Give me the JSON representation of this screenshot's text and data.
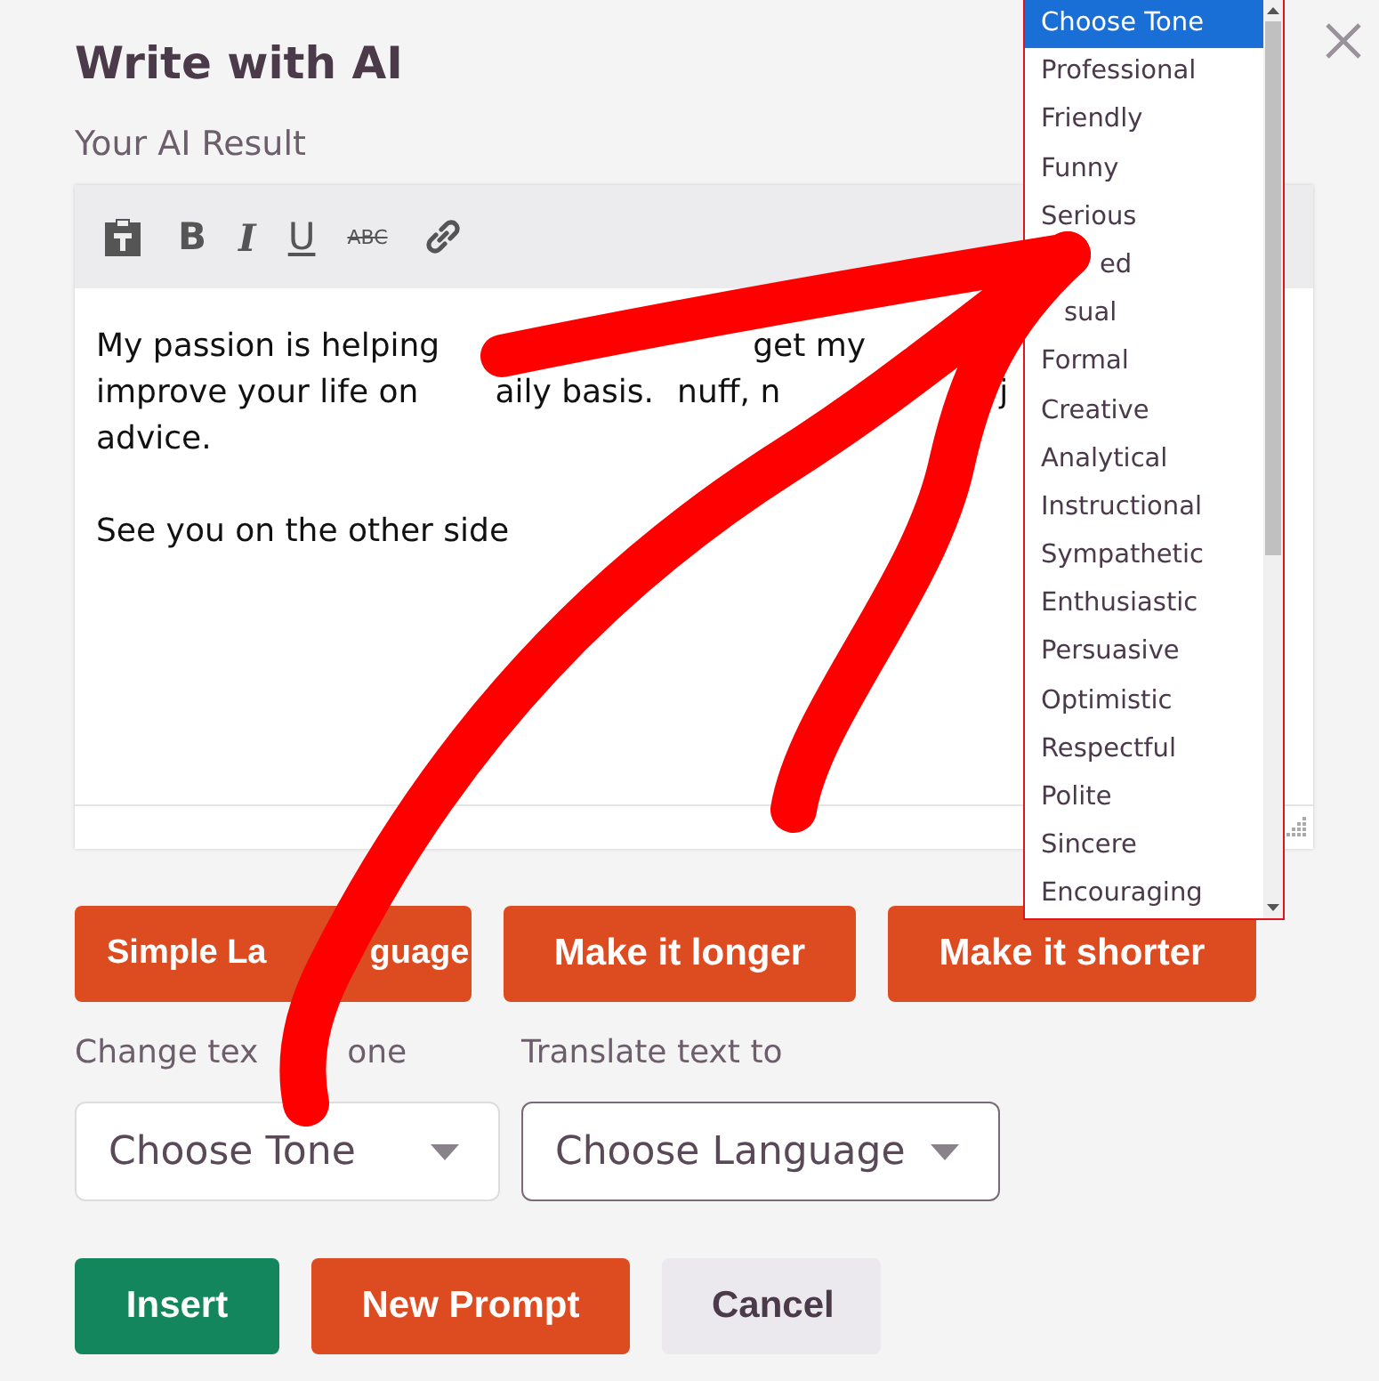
{
  "dialog": {
    "title": "Write with AI"
  },
  "result_label": "Your AI Result",
  "toolbar": [
    {
      "kind": "paste"
    },
    {
      "kind": "bold",
      "label": "B"
    },
    {
      "kind": "italic",
      "label": "I"
    },
    {
      "kind": "underline",
      "label": "U"
    },
    {
      "kind": "strikethrough",
      "label": "ABC"
    },
    {
      "kind": "link"
    }
  ],
  "editor": {
    "paragraphs": [
      {
        "lines": [
          [
            "My passion is helping",
            "get my"
          ],
          [
            "improve your life on",
            "aily basis.",
            "nuff, n",
            "j"
          ],
          [
            "advice."
          ]
        ]
      },
      {
        "lines": [
          [
            "See you on the other side"
          ]
        ]
      }
    ]
  },
  "actions": [
    {
      "parts": [
        "Simple La",
        "guage"
      ]
    },
    {
      "parts": [
        "Make it longer"
      ]
    },
    {
      "parts": [
        "Make it shorter"
      ]
    }
  ],
  "tone": {
    "label_parts": [
      "Change tex",
      "one"
    ],
    "value": "Choose Tone"
  },
  "language": {
    "label": "Translate text to",
    "value": "Choose Language"
  },
  "tone_list": {
    "items": [
      {
        "label": "Choose Tone",
        "selected": true
      },
      {
        "label": "Professional",
        "selected": false
      },
      {
        "label": "Friendly",
        "selected": false
      },
      {
        "label": "Funny",
        "selected": false
      },
      {
        "label": "Serious",
        "selected": false
      },
      {
        "label": "ed",
        "selected": false
      },
      {
        "label": "sual",
        "selected": false
      },
      {
        "label": "Formal",
        "selected": false
      },
      {
        "label": "Creative",
        "selected": false
      },
      {
        "label": "Analytical",
        "selected": false
      },
      {
        "label": "Instructional",
        "selected": false
      },
      {
        "label": "Sympathetic",
        "selected": false
      },
      {
        "label": "Enthusiastic",
        "selected": false
      },
      {
        "label": "Persuasive",
        "selected": false
      },
      {
        "label": "Optimistic",
        "selected": false
      },
      {
        "label": "Respectful",
        "selected": false
      },
      {
        "label": "Polite",
        "selected": false
      },
      {
        "label": "Sincere",
        "selected": false
      },
      {
        "label": "Encouraging",
        "selected": false
      }
    ]
  },
  "footer_buttons": [
    {
      "label": "Insert",
      "kind": "primary"
    },
    {
      "label": "New Prompt",
      "kind": "accent"
    },
    {
      "label": "Cancel",
      "kind": "plain"
    }
  ]
}
